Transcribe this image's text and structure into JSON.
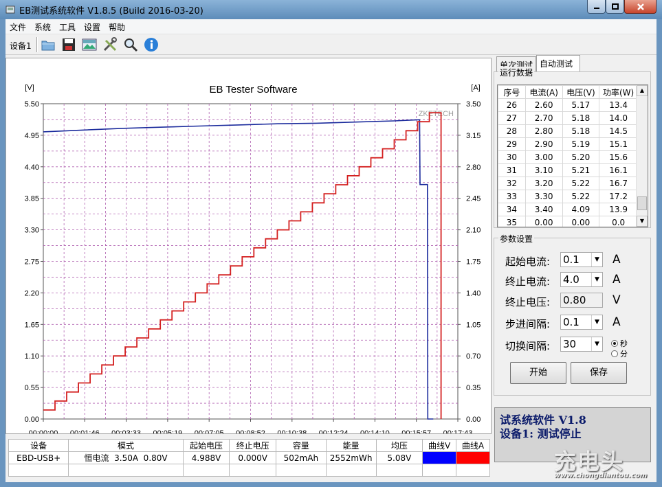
{
  "window": {
    "title": "EB测试系统软件 V1.8.5 (Build 2016-03-20)"
  },
  "menu": [
    "文件",
    "系统",
    "工具",
    "设置",
    "帮助"
  ],
  "toolbar": {
    "device_label": "设备1",
    "icons": [
      "open-folder-icon",
      "save-disk-icon",
      "picture-icon",
      "tools-icon",
      "search-icon",
      "info-icon"
    ]
  },
  "chart_data": {
    "type": "line",
    "title": "EB Tester Software",
    "watermark": "ZKETECH",
    "ylabel_left": "[V]",
    "ylabel_right": "[A]",
    "y_left_ticks": [
      "5.50",
      "4.95",
      "4.40",
      "3.85",
      "3.30",
      "2.75",
      "2.20",
      "1.65",
      "1.10",
      "0.55",
      "0.00"
    ],
    "y_right_ticks": [
      "3.50",
      "3.15",
      "2.80",
      "2.45",
      "2.10",
      "1.75",
      "1.40",
      "1.05",
      "0.70",
      "0.35",
      "0.00"
    ],
    "x_ticks": [
      "00:00:00",
      "00:01:46",
      "00:03:33",
      "00:05:19",
      "00:07:05",
      "00:08:52",
      "00:10:38",
      "00:12:24",
      "00:14:10",
      "00:15:57",
      "00:17:43"
    ],
    "ylim_left": [
      0,
      5.5
    ],
    "ylim_right": [
      0,
      3.5
    ],
    "xlim_seconds": [
      0,
      1063
    ],
    "series": [
      {
        "color": "#1a2a9c",
        "axis": "left",
        "x": [
          0,
          100,
          200,
          300,
          400,
          500,
          600,
          700,
          800,
          900,
          960,
          965,
          966,
          985,
          986,
          1000
        ],
        "y": [
          5.01,
          5.04,
          5.07,
          5.09,
          5.11,
          5.13,
          5.15,
          5.16,
          5.18,
          5.2,
          5.22,
          5.22,
          4.09,
          4.09,
          0.0,
          0.0
        ]
      },
      {
        "color": "#d42020",
        "axis": "right",
        "steps": [
          0.1,
          0.2,
          0.3,
          0.4,
          0.5,
          0.6,
          0.7,
          0.8,
          0.9,
          1.0,
          1.1,
          1.2,
          1.3,
          1.4,
          1.5,
          1.6,
          1.7,
          1.8,
          1.9,
          2.0,
          2.1,
          2.2,
          2.3,
          2.4,
          2.5,
          2.6,
          2.7,
          2.8,
          2.9,
          3.0,
          3.1,
          3.2,
          3.3,
          3.4,
          0.0
        ],
        "step_seconds": 30
      }
    ]
  },
  "summary": {
    "headers": [
      "设备",
      "模式",
      "起始电压",
      "终止电压",
      "容量",
      "能量",
      "均压",
      "曲线V",
      "曲线A"
    ],
    "row": [
      "EBD-USB+",
      "恒电流  3.50A  0.80V",
      "4.988V",
      "0.000V",
      "502mAh",
      "2552mWh",
      "5.08V"
    ],
    "curve_v_color": "#0000ff",
    "curve_a_color": "#ff0000"
  },
  "tabs": [
    "单次测试",
    "自动测试"
  ],
  "run": {
    "legend": "运行数据",
    "headers": [
      "序号",
      "电流(A)",
      "电压(V)",
      "功率(W)"
    ],
    "rows": [
      [
        "26",
        "2.60",
        "5.17",
        "13.4"
      ],
      [
        "27",
        "2.70",
        "5.18",
        "14.0"
      ],
      [
        "28",
        "2.80",
        "5.18",
        "14.5"
      ],
      [
        "29",
        "2.90",
        "5.19",
        "15.1"
      ],
      [
        "30",
        "3.00",
        "5.20",
        "15.6"
      ],
      [
        "31",
        "3.10",
        "5.21",
        "16.1"
      ],
      [
        "32",
        "3.20",
        "5.22",
        "16.7"
      ],
      [
        "33",
        "3.30",
        "5.22",
        "17.2"
      ],
      [
        "34",
        "3.40",
        "4.09",
        "13.9"
      ],
      [
        "35",
        "0.00",
        "0.00",
        "0.0"
      ]
    ]
  },
  "params": {
    "legend": "参数设置",
    "start_current_label": "起始电流:",
    "start_current": "0.1",
    "start_current_unit": "A",
    "end_current_label": "终止电流:",
    "end_current": "4.0",
    "end_current_unit": "A",
    "end_voltage_label": "终止电压:",
    "end_voltage": "0.80",
    "end_voltage_unit": "V",
    "step_label": "步进间隔:",
    "step": "0.1",
    "step_unit": "A",
    "switch_label": "切换间隔:",
    "switch": "30",
    "unit_sec": "秒",
    "unit_min": "分",
    "start_button": "开始",
    "save_button": "保存"
  },
  "status": {
    "line1": "试系统软件 V1.8",
    "line2": "设备1: 测试停止"
  },
  "watermark": {
    "big": "充电头",
    "small": "www.chongdiantou.com"
  }
}
